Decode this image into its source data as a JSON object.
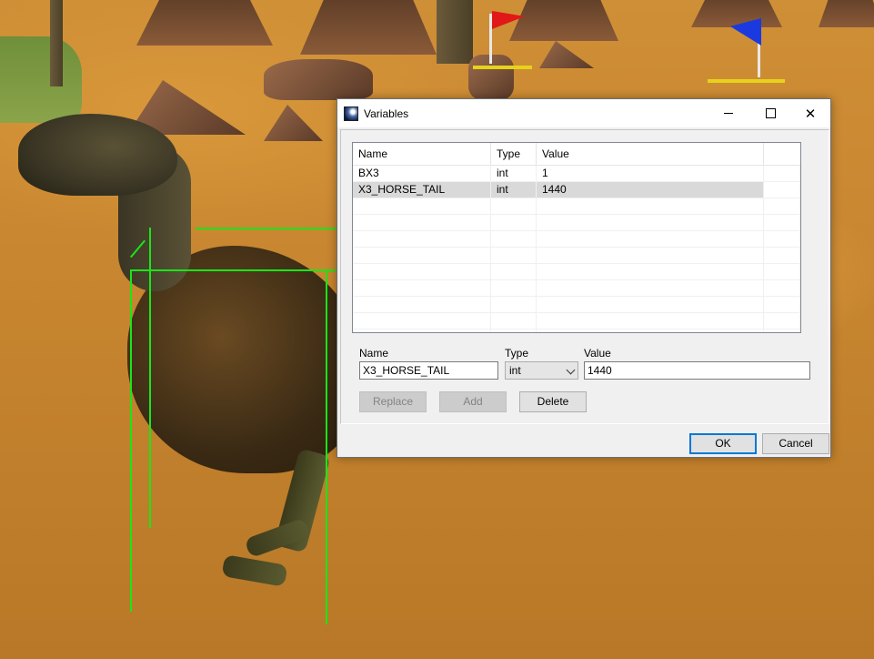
{
  "dialog": {
    "title": "Variables",
    "window_buttons": {
      "minimize": "minimize-icon",
      "maximize": "maximize-icon",
      "close": "close-icon"
    },
    "list": {
      "columns": [
        "Name",
        "Type",
        "Value"
      ],
      "rows": [
        {
          "name": "BX3",
          "type": "int",
          "value": "1"
        },
        {
          "name": "X3_HORSE_TAIL",
          "type": "int",
          "value": "1440"
        }
      ],
      "selected_row": 1
    },
    "editor": {
      "name_label": "Name",
      "type_label": "Type",
      "value_label": "Value",
      "name_value": "X3_HORSE_TAIL",
      "type_value": "int",
      "value_value": "1440"
    },
    "buttons": {
      "replace": "Replace",
      "add": "Add",
      "delete": "Delete",
      "ok": "OK",
      "cancel": "Cancel"
    }
  },
  "colors": {
    "bounding_box": "#19e619",
    "selection": "#d9d9d9",
    "sand": "#c88630"
  }
}
